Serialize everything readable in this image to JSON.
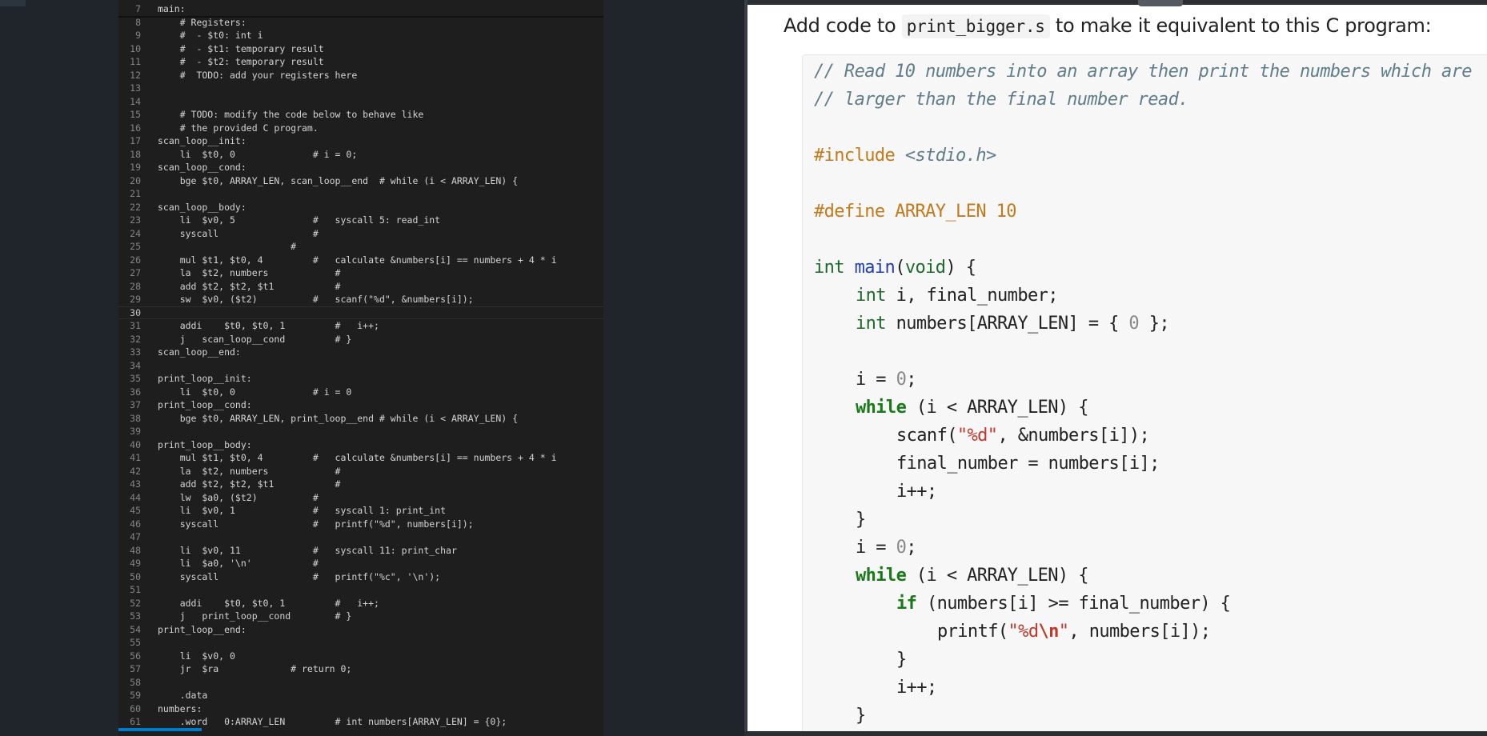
{
  "editor": {
    "lines": [
      {
        "n": "7",
        "t": "main:"
      },
      {
        "n": "8",
        "t": "    # Registers:"
      },
      {
        "n": "9",
        "t": "    #  - $t0: int i"
      },
      {
        "n": "10",
        "t": "    #  - $t1: temporary result"
      },
      {
        "n": "11",
        "t": "    #  - $t2: temporary result"
      },
      {
        "n": "12",
        "t": "    #  TODO: add your registers here"
      },
      {
        "n": "13",
        "t": ""
      },
      {
        "n": "14",
        "t": ""
      },
      {
        "n": "15",
        "t": "    # TODO: modify the code below to behave like"
      },
      {
        "n": "16",
        "t": "    # the provided C program."
      },
      {
        "n": "17",
        "t": "scan_loop__init:"
      },
      {
        "n": "18",
        "t": "    li  $t0, 0              # i = 0;"
      },
      {
        "n": "19",
        "t": "scan_loop__cond:"
      },
      {
        "n": "20",
        "t": "    bge $t0, ARRAY_LEN, scan_loop__end  # while (i < ARRAY_LEN) {"
      },
      {
        "n": "21",
        "t": ""
      },
      {
        "n": "22",
        "t": "scan_loop__body:"
      },
      {
        "n": "23",
        "t": "    li  $v0, 5              #   syscall 5: read_int"
      },
      {
        "n": "24",
        "t": "    syscall                 #"
      },
      {
        "n": "25",
        "t": "                        #"
      },
      {
        "n": "26",
        "t": "    mul $t1, $t0, 4         #   calculate &numbers[i] == numbers + 4 * i"
      },
      {
        "n": "27",
        "t": "    la  $t2, numbers            #"
      },
      {
        "n": "28",
        "t": "    add $t2, $t2, $t1           #"
      },
      {
        "n": "29",
        "t": "    sw  $v0, ($t2)          #   scanf(\"%d\", &numbers[i]);"
      },
      {
        "n": "30",
        "t": ""
      },
      {
        "n": "31",
        "t": "    addi    $t0, $t0, 1         #   i++;"
      },
      {
        "n": "32",
        "t": "    j   scan_loop__cond         # }"
      },
      {
        "n": "33",
        "t": "scan_loop__end:"
      },
      {
        "n": "34",
        "t": ""
      },
      {
        "n": "35",
        "t": "print_loop__init:"
      },
      {
        "n": "36",
        "t": "    li  $t0, 0              # i = 0"
      },
      {
        "n": "37",
        "t": "print_loop__cond:"
      },
      {
        "n": "38",
        "t": "    bge $t0, ARRAY_LEN, print_loop__end # while (i < ARRAY_LEN) {"
      },
      {
        "n": "39",
        "t": ""
      },
      {
        "n": "40",
        "t": "print_loop__body:"
      },
      {
        "n": "41",
        "t": "    mul $t1, $t0, 4         #   calculate &numbers[i] == numbers + 4 * i"
      },
      {
        "n": "42",
        "t": "    la  $t2, numbers            #"
      },
      {
        "n": "43",
        "t": "    add $t2, $t2, $t1           #"
      },
      {
        "n": "44",
        "t": "    lw  $a0, ($t2)          #"
      },
      {
        "n": "45",
        "t": "    li  $v0, 1              #   syscall 1: print_int"
      },
      {
        "n": "46",
        "t": "    syscall                 #   printf(\"%d\", numbers[i]);"
      },
      {
        "n": "47",
        "t": ""
      },
      {
        "n": "48",
        "t": "    li  $v0, 11             #   syscall 11: print_char"
      },
      {
        "n": "49",
        "t": "    li  $a0, '\\n'           #"
      },
      {
        "n": "50",
        "t": "    syscall                 #   printf(\"%c\", '\\n');"
      },
      {
        "n": "51",
        "t": ""
      },
      {
        "n": "52",
        "t": "    addi    $t0, $t0, 1         #   i++;"
      },
      {
        "n": "53",
        "t": "    j   print_loop__cond        # }"
      },
      {
        "n": "54",
        "t": "print_loop__end:"
      },
      {
        "n": "55",
        "t": ""
      },
      {
        "n": "56",
        "t": "    li  $v0, 0"
      },
      {
        "n": "57",
        "t": "    jr  $ra             # return 0;"
      },
      {
        "n": "58",
        "t": ""
      },
      {
        "n": "59",
        "t": "    .data"
      },
      {
        "n": "60",
        "t": "numbers:"
      },
      {
        "n": "61",
        "t": "    .word   0:ARRAY_LEN         # int numbers[ARRAY_LEN] = {0};"
      }
    ]
  },
  "doc": {
    "instruction_prefix": "Add code to ",
    "instruction_file": "print_bigger.s",
    "instruction_suffix": " to make it equivalent to this C program:",
    "c": {
      "comment1": "// Read 10 numbers into an array then print the numbers which are",
      "comment2": "// larger than the final number read.",
      "include_kw": "#include",
      "include_hdr": "<stdio.h>",
      "define_kw": "#define",
      "define_rest": "ARRAY_LEN 10",
      "int1": "int",
      "main_fn": "main",
      "main_lp": "(",
      "void_kw": "void",
      "main_rest": ") {",
      "int2": "int",
      "decl1": " i, final_number;",
      "int3": "int",
      "decl2a": " numbers[ARRAY_LEN] = { ",
      "zero1": "0",
      "decl2b": " };",
      "assign1a": "i = ",
      "zero2": "0",
      "assign1b": ";",
      "while1": "while",
      "while1_rest": " (i < ARRAY_LEN) {",
      "scanf_a": "scanf(",
      "scanf_str": "\"%d\"",
      "scanf_b": ", &numbers[i]);",
      "final_assign": "final_number = numbers[i];",
      "inc1": "i++;",
      "close1": "}",
      "assign2a": "i = ",
      "zero3": "0",
      "assign2b": ";",
      "while2": "while",
      "while2_rest": " (i < ARRAY_LEN) {",
      "if_kw": "if",
      "if_rest": " (numbers[i] >= final_number) {",
      "printf_a": "printf(",
      "printf_s1": "\"%d",
      "printf_esc": "\\n",
      "printf_s2": "\"",
      "printf_b": ", numbers[i]);",
      "close2": "}",
      "inc2": "i++;",
      "close3": "}"
    }
  }
}
